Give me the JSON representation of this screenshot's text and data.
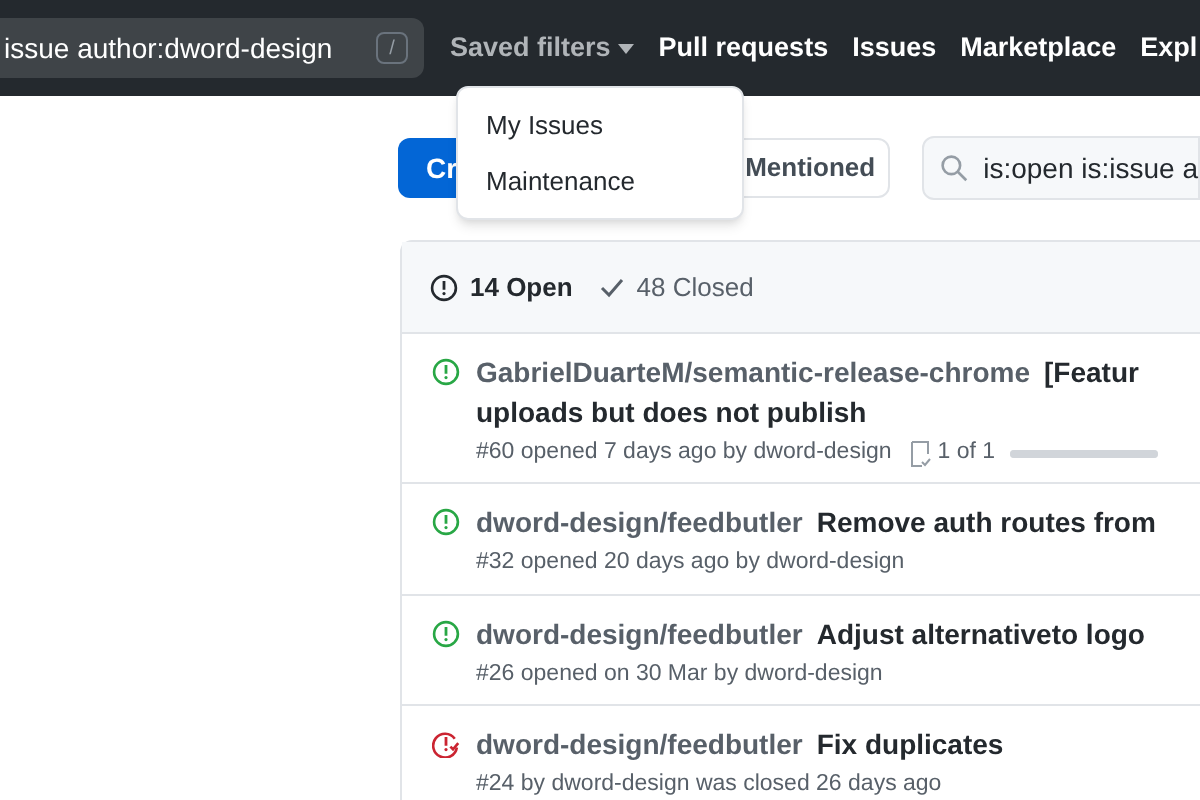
{
  "header": {
    "search_value": "issue author:dword-design",
    "search_key": "/",
    "nav": [
      {
        "label": "Saved filters",
        "expanded": true
      },
      {
        "label": "Pull requests",
        "expanded": false
      },
      {
        "label": "Issues",
        "expanded": false
      },
      {
        "label": "Marketplace",
        "expanded": false
      },
      {
        "label": "Expl",
        "expanded": false
      }
    ]
  },
  "saved_filters_menu": [
    "My Issues",
    "Maintenance"
  ],
  "toolbar": {
    "create_button": "Cr",
    "mentioned_button": "Mentioned",
    "search_value": "is:open is:issue a"
  },
  "issues_list": {
    "tabs": [
      {
        "label": "14 Open",
        "selected": true
      },
      {
        "label": "48 Closed",
        "selected": false
      }
    ],
    "rows": [
      {
        "kind": "open",
        "repo": "GabrielDuarteM/semantic-release-chrome",
        "title": "[Featur",
        "title_line2": "uploads but does not publish",
        "meta": "#60 opened 7 days ago by dword-design",
        "tasks": {
          "text": "1 of 1",
          "level": 1
        }
      },
      {
        "kind": "open",
        "repo": "dword-design/feedbutler",
        "title": "Remove auth routes from",
        "meta": "#32 opened 20 days ago by dword-design"
      },
      {
        "kind": "open",
        "repo": "dword-design/feedbutler",
        "title": "Adjust alternativeto logo",
        "meta": "#26 opened on 30 Mar by dword-design"
      },
      {
        "kind": "closed",
        "repo": "dword-design/feedbutler",
        "title": "Fix duplicates",
        "meta": "#24 by dword-design was closed 26 days ago"
      }
    ]
  }
}
